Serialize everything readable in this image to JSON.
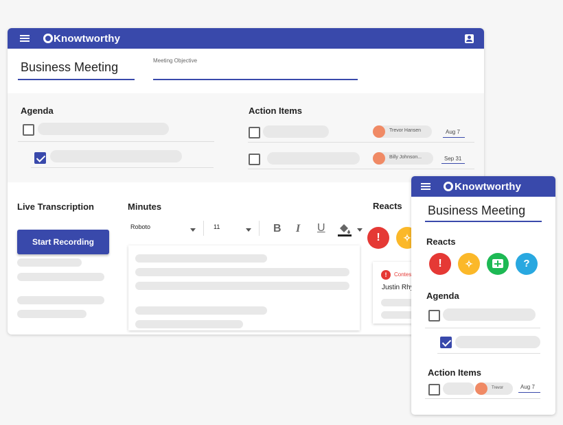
{
  "app": {
    "brand": "Knowtworthy",
    "meeting_title": "Business Meeting",
    "objective_label": "Meeting Objective"
  },
  "agenda": {
    "title": "Agenda",
    "items": [
      {
        "checked": false
      },
      {
        "checked": true,
        "indented": true
      }
    ]
  },
  "action_items": {
    "title": "Action Items",
    "items": [
      {
        "assignee": "Trevor Hansen",
        "due": "Aug 7",
        "checked": false
      },
      {
        "assignee": "Billy Johnson...",
        "due": "Sep 31",
        "checked": false
      }
    ]
  },
  "live_transcription": {
    "title": "Live Transcription",
    "button_label": "Start Recording"
  },
  "minutes": {
    "title": "Minutes",
    "font_family": "Roboto",
    "font_size": "11",
    "bold_icon": "B",
    "italic_icon": "I",
    "underline_icon": "U"
  },
  "reacts": {
    "title": "Reacts",
    "buttons": [
      {
        "icon": "exclamation-icon",
        "glyph": "!",
        "color": "#e53935"
      },
      {
        "icon": "lightbulb-icon",
        "glyph": "✧",
        "color": "#fbb829"
      },
      {
        "icon": "add-comment-icon",
        "glyph": "+",
        "color": "#1db954"
      },
      {
        "icon": "question-icon",
        "glyph": "?",
        "color": "#29a8e0"
      }
    ],
    "card": {
      "tag": "Contes",
      "name": "Justin Rhy"
    }
  },
  "mobile": {
    "brand": "Knowtworthy",
    "meeting_title": "Business Meeting",
    "reacts_title": "Reacts",
    "agenda_title": "Agenda",
    "action_items_title": "Action Items",
    "action_assignee": "Trevor",
    "action_due": "Aug 7"
  },
  "colors": {
    "primary": "#3949ab",
    "avatar": "#f08a65"
  }
}
